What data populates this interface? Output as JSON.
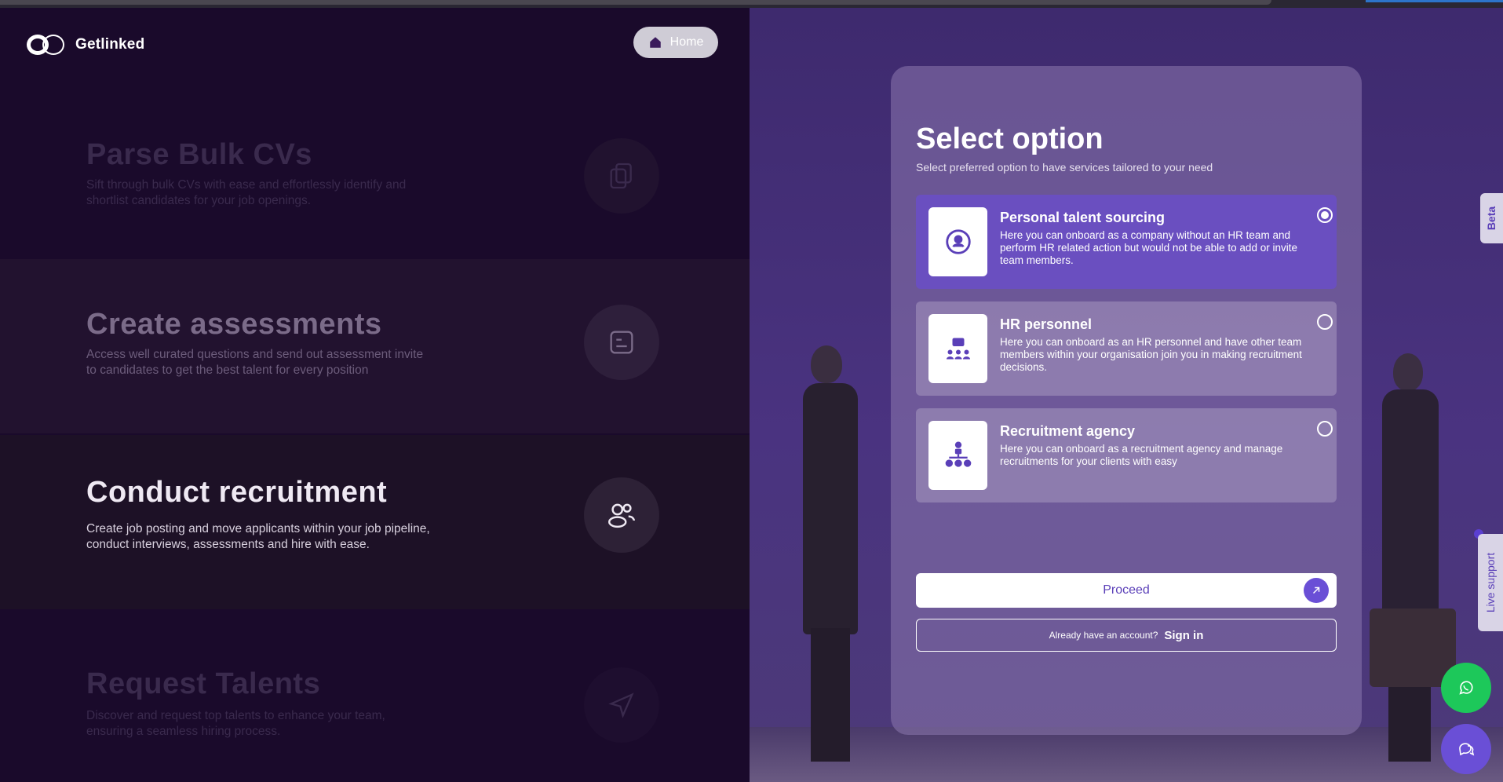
{
  "brand": {
    "name": "Getlinked"
  },
  "header": {
    "home_label": "Home"
  },
  "features": [
    {
      "title": "Parse Bulk CVs",
      "desc": "Sift through bulk CVs with ease and effortlessly identify and shortlist candidates for your job openings.",
      "icon": "documents-icon"
    },
    {
      "title": "Create assessments",
      "desc": "Access well curated questions and send out assessment invite to candidates to get the best talent for every position",
      "icon": "assessment-icon"
    },
    {
      "title": "Conduct recruitment",
      "desc": "Create job posting and move applicants within your job pipeline, conduct interviews, assessments and hire with ease.",
      "icon": "users-icon"
    },
    {
      "title": "Request Talents",
      "desc": "Discover and request top talents to enhance your team, ensuring a seamless hiring process.",
      "icon": "send-icon"
    }
  ],
  "select": {
    "heading": "Select option",
    "subheading": "Select preferred option to have services tailored to your need",
    "options": [
      {
        "title": "Personal talent sourcing",
        "desc": "Here you can onboard as a company without an HR team and perform HR related action but would not be able to add or invite team members.",
        "selected": true
      },
      {
        "title": "HR personnel",
        "desc": "Here you can onboard as an HR personnel and have other team members within your organisation join you in making recruitment decisions.",
        "selected": false
      },
      {
        "title": "Recruitment agency",
        "desc": "Here you can onboard as a recruitment agency and manage recruitments for your clients with easy",
        "selected": false
      }
    ],
    "proceed_label": "Proceed",
    "signin_question": "Already have an account?",
    "signin_label": "Sign in"
  },
  "side_tabs": {
    "beta": "Beta",
    "live_support": "Live support"
  },
  "colors": {
    "accent": "#6a4fd6",
    "whatsapp": "#1dc85a",
    "left_bg": "#1a0a2b"
  }
}
